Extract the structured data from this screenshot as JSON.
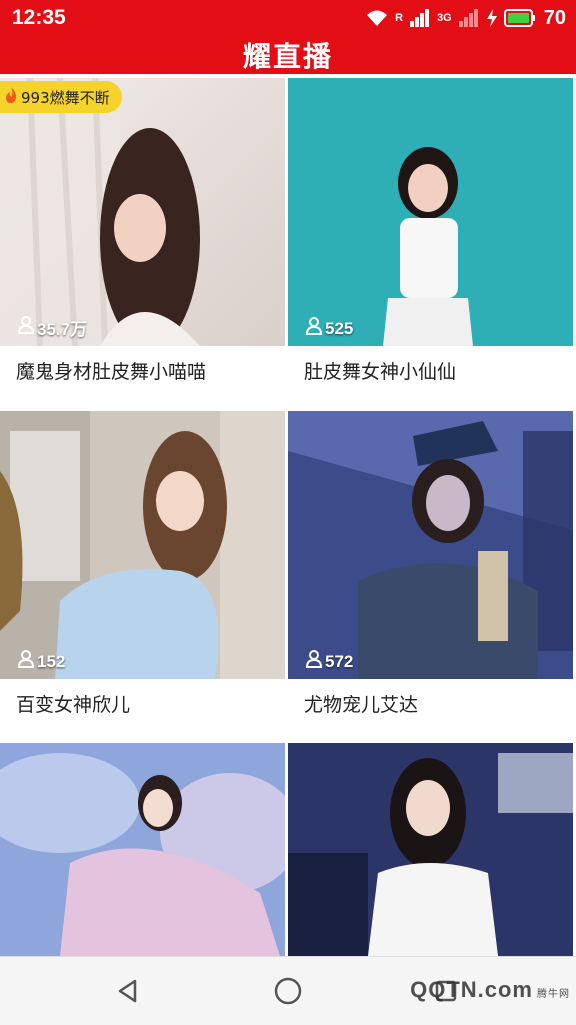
{
  "status_bar": {
    "time": "12:35",
    "signal_label": "R",
    "network": "3G",
    "battery": "70"
  },
  "header": {
    "title": "耀直播"
  },
  "badge": {
    "text": "993燃舞不断",
    "icon": "flame-icon"
  },
  "streams": [
    {
      "name": "魔鬼身材肚皮舞小喵喵",
      "viewers": "35.7万"
    },
    {
      "name": "肚皮舞女神小仙仙",
      "viewers": "525"
    },
    {
      "name": "百变女神欣儿",
      "viewers": "152"
    },
    {
      "name": "尤物宠儿艾达",
      "viewers": "572"
    },
    {
      "name": "",
      "viewers": ""
    },
    {
      "name": "",
      "viewers": ""
    }
  ],
  "nav": {
    "back_icon": "back-triangle-icon",
    "home_icon": "home-circle-icon",
    "recent_icon": "recent-square-icon"
  },
  "watermark": {
    "text": "QQTN.com",
    "small": "腾牛网"
  },
  "colors": {
    "brand_red": "#e30d16",
    "badge_yellow": "#f6d32a"
  }
}
